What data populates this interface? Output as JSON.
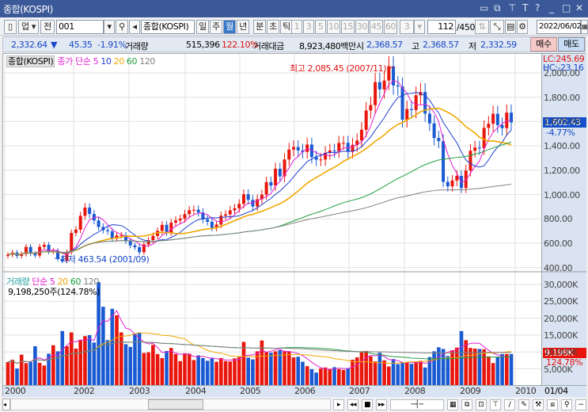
{
  "window": {
    "title": "종합(KOSPI)",
    "icons": [
      "restore-icon",
      "copy-icon",
      "pin-icon",
      "text-icon",
      "help-icon",
      "minimize-icon",
      "maximize-icon",
      "close-icon"
    ]
  },
  "toolbar": {
    "market": "업",
    "prev": "전",
    "code": "001",
    "name": "종합(KOSPI)",
    "periods": [
      "일",
      "주",
      "월",
      "년",
      "분",
      "초",
      "틱"
    ],
    "active_period": "월",
    "minutes": [
      "1",
      "3",
      "5",
      "10",
      "15",
      "30",
      "45",
      "60"
    ],
    "count_select": "3",
    "bar_count": "112",
    "bar_total": "/450",
    "date": "2022/06/02"
  },
  "quote": {
    "price": "2,332.64",
    "arrow": "▼",
    "change": "45.35",
    "change_pct": "-1.91%",
    "vol_label": "거래량",
    "volume": "515,396",
    "vol_ratio": "122.10%",
    "amt_label": "거래대금",
    "amount": "8,923,480백만",
    "open_label": "시",
    "open": "2,368.57",
    "high_label": "고",
    "high": "2,368.57",
    "low_label": "저",
    "low": "2,332.59",
    "buy": "매수",
    "sell": "매도"
  },
  "price_pane": {
    "title": "종합(KOSPI)",
    "ma_label": "종가 단순",
    "ma": [
      "5",
      "10",
      "20",
      "60",
      "120"
    ],
    "lc": "LC:245.69",
    "hc": "HC:-23.16",
    "high_note": "최고 2,085.45 (2007/11)",
    "low_note": "최저 463.54 (2001/09)",
    "current": "1,602.43",
    "current_pct": "-4.77%",
    "ticks": [
      "2,000.00",
      "1,800.00",
      "1,600.00",
      "1,400.00",
      "1,200.00",
      "1,000.00",
      "800.00",
      "600.00",
      "400.00"
    ]
  },
  "volume_pane": {
    "title": "거래량",
    "ma_label": "단순",
    "ma": [
      "5",
      "20",
      "60",
      "120"
    ],
    "info": "9,198,250주(124.78%)",
    "current": "9,198K",
    "current_pct": "124.78%",
    "ticks": [
      "30,000K",
      "25,000K",
      "20,000K",
      "15,000K",
      "10,000K",
      "5,000K"
    ]
  },
  "xaxis": {
    "labels": [
      "2000",
      "2002",
      "2003",
      "2004",
      "2005",
      "2006",
      "2007",
      "2008",
      "2009",
      "2010"
    ],
    "right": "01/04"
  },
  "colors": {
    "up": "#e8160c",
    "down": "#1a5ad2",
    "ma5": "#e020d0",
    "ma10": "#2040d0",
    "ma20": "#f0a800",
    "ma60": "#20a040",
    "ma120": "#808080"
  },
  "series": {
    "closes": [
      514,
      532,
      504,
      520,
      578,
      523,
      508,
      579,
      595,
      541,
      546,
      479,
      463,
      535,
      693,
      720,
      834,
      902,
      849,
      796,
      742,
      716,
      707,
      647,
      672,
      674,
      627,
      591,
      576,
      535,
      599,
      634,
      669,
      710,
      760,
      697,
      778,
      796,
      810,
      848,
      880,
      884,
      862,
      804,
      785,
      736,
      762,
      835,
      846,
      879,
      896,
      932,
      1011,
      965,
      911,
      970,
      1008,
      1111,
      1083,
      1221,
      1158,
      1297,
      1379,
      1399,
      1372,
      1359,
      1420,
      1317,
      1295,
      1297,
      1352,
      1371,
      1365,
      1433,
      1434,
      1360,
      1417,
      1453,
      1542,
      1700,
      1744,
      1933,
      1873,
      1946,
      2064,
      1906,
      1897,
      1624,
      1712,
      1704,
      1825,
      1852,
      1674,
      1594,
      1474,
      1448,
      1113,
      1076,
      1124,
      1162,
      1063,
      1206,
      1369,
      1395,
      1390,
      1557,
      1591,
      1673,
      1580,
      1555,
      1682,
      1602
    ],
    "volumes": [
      6800,
      7500,
      4900,
      9000,
      6500,
      6800,
      11500,
      6600,
      5800,
      9300,
      11800,
      10000,
      16000,
      11500,
      15600,
      10800,
      13200,
      14500,
      14800,
      12600,
      30500,
      23200,
      13300,
      22600,
      20700,
      15600,
      12100,
      11300,
      15200,
      15400,
      9500,
      9700,
      11900,
      9200,
      8000,
      10100,
      11000,
      9200,
      7100,
      9300,
      9300,
      7400,
      8800,
      8000,
      7200,
      8100,
      6900,
      8000,
      7100,
      7000,
      7900,
      8300,
      12800,
      8100,
      7600,
      10000,
      13200,
      9800,
      9600,
      10000,
      10300,
      10100,
      9900,
      8200,
      8400,
      6900,
      5600,
      4700,
      3700,
      4900,
      5200,
      4800,
      5300,
      4700,
      4500,
      5000,
      7500,
      8200,
      9700,
      10100,
      8500,
      7000,
      9600,
      7300,
      5500,
      7700,
      6200,
      6800,
      6800,
      6300,
      6800,
      7200,
      5200,
      8300,
      10000,
      11200,
      10700,
      8600,
      10300,
      11100,
      16000,
      13300,
      11000,
      10800,
      10700,
      10600,
      8500,
      6500,
      8300,
      9198,
      9198,
      9198
    ]
  }
}
